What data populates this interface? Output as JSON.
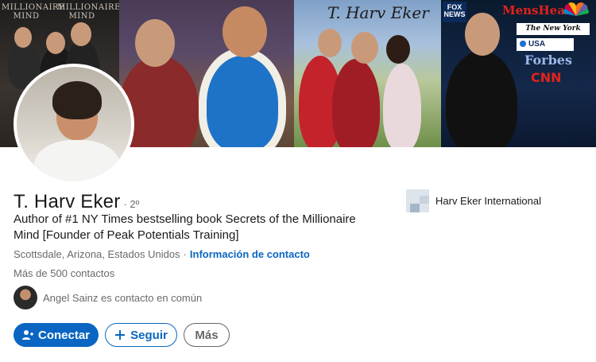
{
  "banner": {
    "brand_text_left": "MILLIONAIRE MIND",
    "brand_text_right": "MILLIONAIRE MIND",
    "signature": "T. Harv Eker",
    "media_logos": {
      "fox": "FOX NEWS",
      "menshealth": "MensHealth",
      "nyt": "The New York Times",
      "usatoday": "USA TODAY",
      "forbes": "Forbes",
      "cnn": "CNN"
    }
  },
  "profile": {
    "name": "T. Harv Eker",
    "degree": "· 2º",
    "headline": "Author of #1 NY Times bestselling book Secrets of the Millionaire Mind [Founder of Peak Potentials Training]",
    "location": "Scottsdale, Arizona, Estados Unidos",
    "separator": "·",
    "contact_info": "Información de contacto",
    "connections": "Más de 500",
    "connections_suffix": "contactos",
    "mutual_name": "Angel Sainz",
    "mutual_suffix": "es contacto en común"
  },
  "company": {
    "name": "Harv Eker International"
  },
  "actions": {
    "connect": "Conectar",
    "follow": "Seguir",
    "more": "Más"
  },
  "colors": {
    "primary": "#0a66c2",
    "text": "#191919",
    "muted": "#666666"
  },
  "icons": {
    "connect": "add-person-icon",
    "follow": "plus-icon"
  }
}
